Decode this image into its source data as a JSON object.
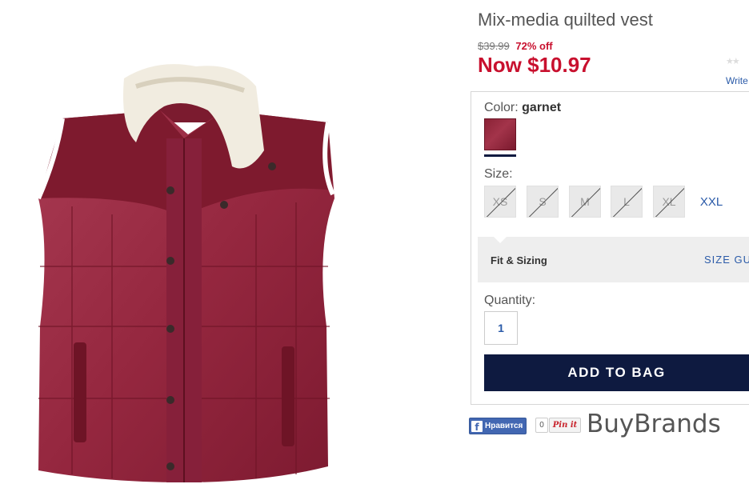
{
  "product": {
    "title": "Mix-media quilted vest",
    "original_price": "$39.99",
    "discount": "72% off",
    "now_price": "Now $10.97",
    "review_stars": "★★",
    "write_review_label": "Write"
  },
  "color": {
    "label": "Color:",
    "selected": "garnet",
    "swatch_color": "#8a2236"
  },
  "sizes": {
    "label": "Size:",
    "options": [
      {
        "label": "XS",
        "available": false
      },
      {
        "label": "S",
        "available": false
      },
      {
        "label": "M",
        "available": false
      },
      {
        "label": "L",
        "available": false
      },
      {
        "label": "XL",
        "available": false
      },
      {
        "label": "XXL",
        "available": true
      }
    ]
  },
  "fit": {
    "label": "Fit & Sizing",
    "size_guide_label": "SIZE GUIDE"
  },
  "quantity": {
    "label": "Quantity:",
    "value": "1"
  },
  "actions": {
    "add_to_bag": "ADD TO BAG"
  },
  "social": {
    "fb_like_label": "Нравится",
    "pin_count": "0",
    "pin_label": "Pin it"
  },
  "brand": "BuyBrands",
  "colors": {
    "accent_red": "#c8102e",
    "navy": "#0e1a40",
    "link_blue": "#2a5aa8",
    "garment": "#9b2c42"
  }
}
